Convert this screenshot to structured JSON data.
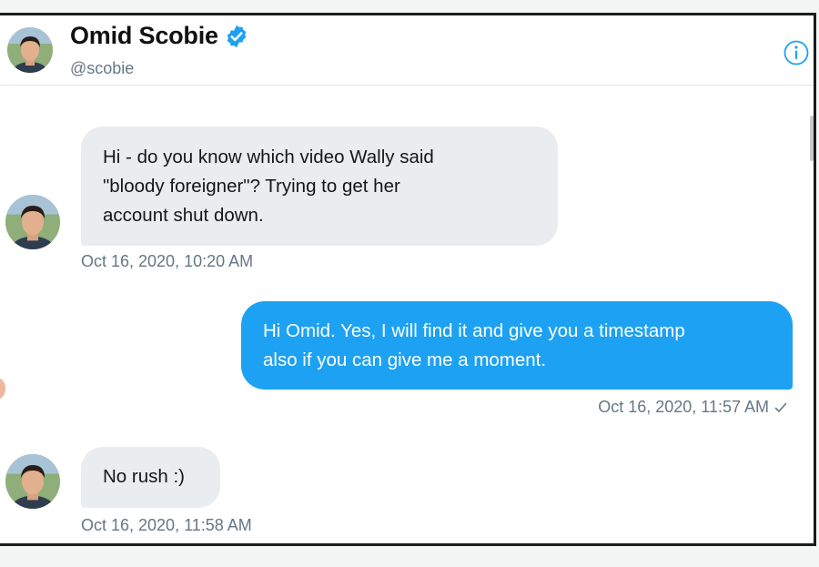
{
  "header": {
    "display_name": "Omid Scobie",
    "handle": "@scobie",
    "verified_icon": "verified-badge-icon",
    "info_icon": "info-icon",
    "avatar": "avatar"
  },
  "messages": [
    {
      "direction": "incoming",
      "text": "Hi - do you know which video Wally said \"bloody foreigner\"? Trying to get her account shut down.",
      "lines": [
        "Hi - do you know which video Wally said",
        "\"bloody foreigner\"? Trying to get her",
        "account shut down."
      ],
      "timestamp": "Oct 16, 2020, 10:20 AM"
    },
    {
      "direction": "outgoing",
      "text": "Hi Omid. Yes, I will find it and give you a timestamp also if you can give me a moment.",
      "lines": [
        "Hi Omid. Yes, I will find it and give you a timestamp",
        "also if you can give me a moment."
      ],
      "timestamp": "Oct 16, 2020, 11:57 AM",
      "status_icon": "check-icon"
    },
    {
      "direction": "incoming",
      "text": "No rush :)",
      "lines": [
        "No rush :)"
      ],
      "timestamp": "Oct 16, 2020, 11:58 AM"
    }
  ],
  "colors": {
    "accent": "#1da1f2",
    "incoming_bubble": "#e9edf0",
    "secondary_text": "#657786",
    "primary_text": "#14171a"
  }
}
